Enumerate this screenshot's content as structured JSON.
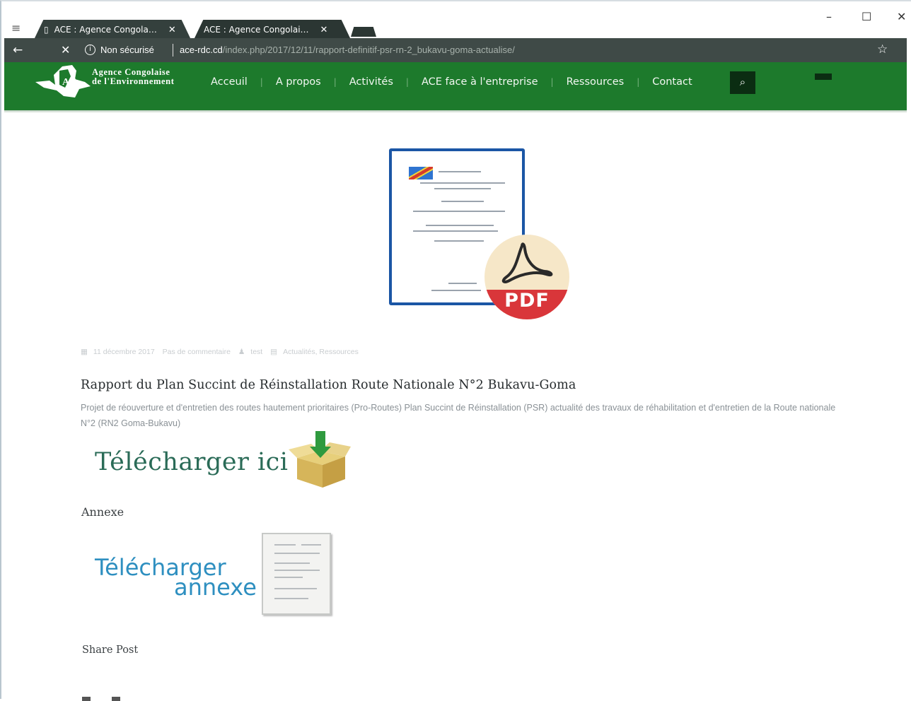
{
  "browser": {
    "tabs": [
      {
        "label": "ACE : Agence Congola…"
      },
      {
        "label": "ACE : Agence Congolai…"
      }
    ],
    "tab_close_glyph": "✕",
    "window_controls": {
      "minimize": "–",
      "maximize": "☐",
      "close": "✕"
    },
    "address": {
      "security_text": "Non sécurisé",
      "domain": "ace-rdc.cd",
      "path": "/index.php/2017/12/11/rapport-definitif-psr-rn-2_bukavu-goma-actualise/"
    },
    "icons": {
      "menu": "menu-icon",
      "back": "back-arrow-icon",
      "stop": "stop-icon",
      "info": "info-icon",
      "star": "bookmark-star-icon"
    }
  },
  "site": {
    "logo_line1": "Agence Congolaise",
    "logo_line2": "de l'Environnement",
    "nav": [
      "Acceuil",
      "A propos",
      "Activités",
      "ACE face à l'entreprise",
      "Ressources",
      "Contact"
    ],
    "accent_color": "#1d7a2c"
  },
  "feature": {
    "pdf_label": "PDF"
  },
  "post": {
    "meta": [
      "11 décembre 2017",
      "Pas de commentaire",
      "test",
      "Actualités, Ressources"
    ],
    "title": "Rapport du Plan Succint de Réinstallation Route Nationale N°2 Bukavu-Goma",
    "excerpt": "Projet de réouverture et d'entretien des routes hautement prioritaires (Pro-Routes) Plan Succint de Réinstallation (PSR) actualité des travaux de réhabilitation et d'entretien de la Route nationale N°2 (RN2 Goma-Bukavu)",
    "download_label": "Télécharger ici",
    "annexe_heading": "Annexe",
    "annexe_download_line1": "Télécharger",
    "annexe_download_line2": "annexe",
    "share_label": "Share Post"
  }
}
